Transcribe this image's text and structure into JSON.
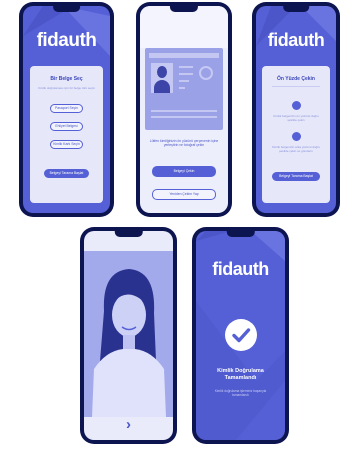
{
  "brand": "fidauth",
  "screen1": {
    "title": "Bir Belge Seç",
    "subtitle": "Kimlik doğrulaması için bir belge türü seçin",
    "options": [
      "Pasaport Seçin",
      "Ehliyet Belgesi",
      "Kimlik Kartı Seçin"
    ],
    "continue": "Belgeyi Tarama Başlat"
  },
  "screen2": {
    "instruction": "Lütfen kimliğinizin ön yüzünü çerçevenin içine yerleştirin ve fotoğraf çekin",
    "primary": "Belgeyi Çekin",
    "secondary": "Yeniden Çekim Yap"
  },
  "screen3": {
    "title": "Ön Yüzde Çekin",
    "step1": "Kimlik belgenizin ön yüzünü doğru şekilde çekin",
    "step2": "Kimlik belgenizin arka yüzünü doğru şekilde çekin ve gönderin",
    "action": "Belgeyi Tarama Başlat"
  },
  "screen4": {
    "next_icon": "chevron-right"
  },
  "screen5": {
    "heading": "Kimlik Doğrulama Tamamlandı",
    "subtext": "Kimlik doğrulama işleminiz başarıyla tamamlandı"
  },
  "colors": {
    "accent": "#5560d6",
    "frame": "#0d1550",
    "card": "#e6e8fa"
  }
}
